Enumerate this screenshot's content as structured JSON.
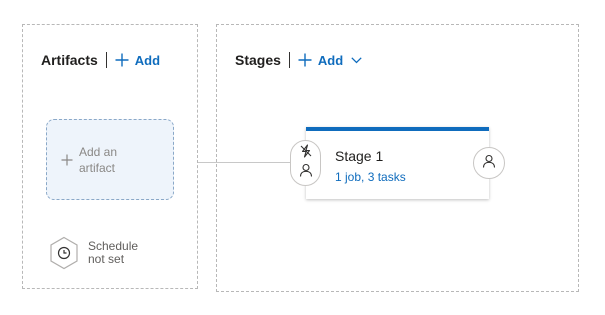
{
  "artifacts": {
    "title": "Artifacts",
    "add_label": "Add",
    "add_artifact_label": "Add an artifact",
    "schedule_label": "Schedule not set"
  },
  "stages": {
    "title": "Stages",
    "add_label": "Add",
    "items": [
      {
        "name": "Stage 1",
        "summary": "1 job, 3 tasks"
      }
    ]
  },
  "icons": {
    "add": "plus-icon",
    "dropdown": "chevron-down-icon",
    "schedule": "clock-icon",
    "trigger": "lightning-icon",
    "approver": "person-icon"
  },
  "colors": {
    "accent": "#0f6cbd",
    "add_artifact_bg": "#eef4fb"
  }
}
